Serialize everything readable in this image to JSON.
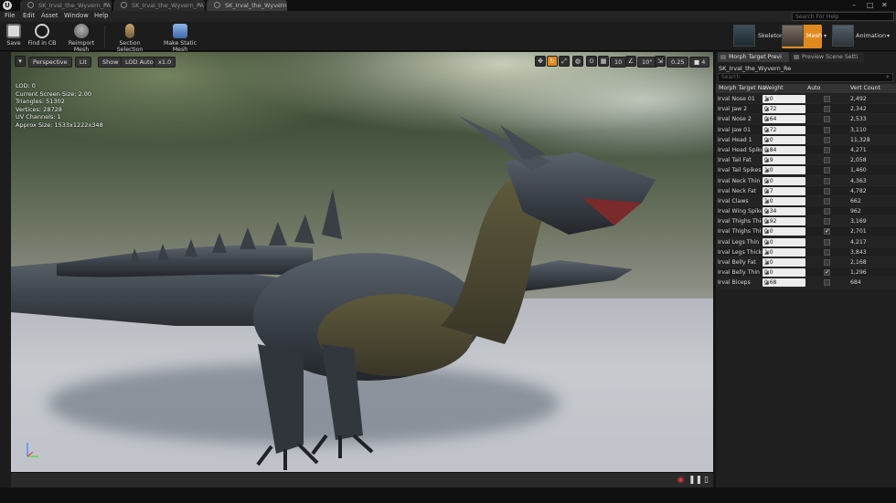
{
  "tabs": [
    {
      "label": "SK_Irval_the_Wyvern_PA A",
      "active": false
    },
    {
      "label": "SK_Irval_the_Wyvern_PA",
      "active": false
    },
    {
      "label": "SK_Irval_the_Wyvern_Re",
      "active": true
    }
  ],
  "menu": [
    "File",
    "Edit",
    "Asset",
    "Window",
    "Help"
  ],
  "help_search": {
    "placeholder": "Search For Help"
  },
  "toolbar": {
    "buttons": [
      {
        "label": "Save",
        "icon": "save-icon"
      },
      {
        "label": "Find in CB",
        "icon": "find-in-content-browser-icon"
      },
      {
        "label": "Reimport Mesh",
        "icon": "reimport-icon"
      },
      {
        "label": "Section Selection",
        "icon": "section-selection-icon"
      },
      {
        "label": "Make Static Mesh",
        "icon": "static-mesh-icon"
      }
    ],
    "modes": [
      {
        "label": "Skeleton",
        "active": false
      },
      {
        "label": "Mesh",
        "active": true
      },
      {
        "label": "Animation",
        "active": false
      }
    ]
  },
  "viewport": {
    "perspective": "Perspective",
    "lit": "Lit",
    "show": "Show",
    "lod": "LOD Auto",
    "speed": "x1.0",
    "grid_size": "10",
    "rotation_snap": "10°",
    "scale_snap": "0.25",
    "camera_speed": "4",
    "stats": [
      "LOD: 0",
      "Current Screen Size: 2.00",
      "Triangles: 51302",
      "Vertices: 28728",
      "UV Channels: 1",
      "Approx Size: 1533x1222x348"
    ]
  },
  "panel": {
    "tab_morph": "Morph Target Previ",
    "tab_scene": "Preview Scene Setti",
    "subject": "SK_Irval_the_Wyvern_Re",
    "search_placeholder": "Search",
    "headers": {
      "name": "Morph Target Na",
      "weight": "Weight",
      "auto": "Auto",
      "verts": "Vert Count"
    },
    "rows": [
      {
        "name": "Irval Nose 01",
        "weight": "1.0",
        "auto": false,
        "verts": "2,492"
      },
      {
        "name": "Irval Jaw 2",
        "weight": "0.72",
        "auto": false,
        "verts": "2,342"
      },
      {
        "name": "Irval Nose 2",
        "weight": "0.64",
        "auto": false,
        "verts": "2,533"
      },
      {
        "name": "Irval Jaw 01",
        "weight": "0.72",
        "auto": false,
        "verts": "3,110"
      },
      {
        "name": "Irval Head 1",
        "weight": "0.0",
        "auto": false,
        "verts": "11,328"
      },
      {
        "name": "Irval Head Spikes",
        "weight": "0.84",
        "auto": false,
        "verts": "4,271"
      },
      {
        "name": "Irval Tail Fat",
        "weight": "0.9",
        "auto": false,
        "verts": "2,058"
      },
      {
        "name": "Irval Tail Spikes",
        "weight": "1.0",
        "auto": false,
        "verts": "1,460"
      },
      {
        "name": "Irval Neck Thin",
        "weight": "0.0",
        "auto": false,
        "verts": "4,363"
      },
      {
        "name": "Irval Neck Fat",
        "weight": "0.7",
        "auto": false,
        "verts": "4,782"
      },
      {
        "name": "Irval Claws",
        "weight": "1.0",
        "auto": false,
        "verts": "662"
      },
      {
        "name": "Irval Wing Spikes",
        "weight": "0.34",
        "auto": false,
        "verts": "962"
      },
      {
        "name": "Irval Thighs Thic",
        "weight": "0.92",
        "auto": false,
        "verts": "3,169"
      },
      {
        "name": "Irval Thighs Thin",
        "weight": "0.0",
        "auto": true,
        "verts": "2,701"
      },
      {
        "name": "Irval Legs Thin",
        "weight": "0.0",
        "auto": false,
        "verts": "4,217"
      },
      {
        "name": "Irval Legs Thick",
        "weight": "1.0",
        "auto": false,
        "verts": "3,843"
      },
      {
        "name": "Irval Belly Fat",
        "weight": "1.0",
        "auto": false,
        "verts": "2,168"
      },
      {
        "name": "Irval Belly Thin",
        "weight": "0.0",
        "auto": true,
        "verts": "1,296"
      },
      {
        "name": "Irval Biceps",
        "weight": "0.68",
        "auto": false,
        "verts": "684"
      }
    ]
  },
  "colors": {
    "accent": "#e08a1e",
    "record": "#d63a3a",
    "panel_bg": "#1f1f1f"
  }
}
